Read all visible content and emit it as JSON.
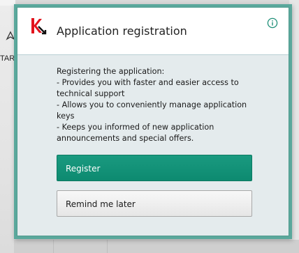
{
  "background": {
    "partial_text": "TAR",
    "icon": "cursor-arrow-icon"
  },
  "dialog": {
    "title": "Application registration",
    "logo": "kaspersky-logo",
    "info_icon": "info-icon",
    "body": {
      "lines": [
        "Registering the application:",
        "- Provides you with faster and easier access to",
        "technical support",
        "- Allows you to conveniently manage application",
        "keys",
        "- Keeps you informed of new application",
        "announcements and special offers."
      ]
    },
    "buttons": {
      "register_label": "Register",
      "remind_label": "Remind me later"
    }
  },
  "colors": {
    "frame": "#5aa89c",
    "primary_button": "#0d8a70",
    "logo_red": "#e2131c",
    "info_green": "#1f8f78"
  }
}
